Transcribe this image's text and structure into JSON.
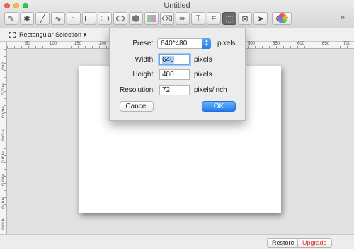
{
  "window": {
    "title": "Untitled"
  },
  "toolbar": {
    "tools": [
      {
        "name": "eyedropper-icon",
        "glyph": "✎"
      },
      {
        "name": "magic-wand-icon",
        "glyph": "✱"
      },
      {
        "name": "line-icon",
        "glyph": "╱"
      },
      {
        "name": "bezier-curve-icon",
        "glyph": "∿"
      },
      {
        "name": "freehand-curve-icon",
        "glyph": "~"
      },
      {
        "name": "rectangle-icon",
        "glyph": ""
      },
      {
        "name": "rounded-rectangle-icon",
        "glyph": ""
      },
      {
        "name": "ellipse-icon",
        "glyph": ""
      },
      {
        "name": "polygon-icon",
        "glyph": ""
      },
      {
        "name": "gradient-icon",
        "glyph": ""
      },
      {
        "name": "eraser-icon",
        "glyph": "⌫"
      },
      {
        "name": "pencil-icon",
        "glyph": "✏"
      },
      {
        "name": "text-icon",
        "glyph": "T"
      },
      {
        "name": "crop-icon",
        "glyph": "⌗"
      },
      {
        "name": "rectangular-selection-icon",
        "glyph": "⬚"
      },
      {
        "name": "magic-selection-icon",
        "glyph": "⊠"
      },
      {
        "name": "pointer-icon",
        "glyph": "➤"
      }
    ],
    "settings_glyph": "⚙ ▾",
    "more_glyph": "»"
  },
  "subbar": {
    "selection_label": "Rectangular Selection",
    "dropdown_glyph": "▾"
  },
  "ruler": {
    "h_ticks": [
      "50",
      "100",
      "150",
      "200",
      "250",
      "300",
      "350",
      "400",
      "450",
      "500",
      "550",
      "600",
      "650",
      "700"
    ],
    "v_ticks": [
      "5\n0",
      "1\n0\n0",
      "1\n5\n0",
      "2\n0\n0",
      "2\n5\n0",
      "3\n0\n0",
      "3\n5\n0",
      "4\n0\n0",
      "4\n5\n0"
    ]
  },
  "dialog": {
    "preset_label": "Preset:",
    "preset_value": "640*480",
    "preset_unit": "pixels",
    "width_label": "Width:",
    "width_value": "640",
    "width_unit": "pixels",
    "height_label": "Height:",
    "height_value": "480",
    "height_unit": "pixels",
    "resolution_label": "Resolution:",
    "resolution_value": "72",
    "resolution_unit": "pixels/inch",
    "cancel_label": "Cancel",
    "ok_label": "OK"
  },
  "bottom": {
    "restore_label": "Restore",
    "upgrade_label": "Upgrade"
  },
  "colors": {
    "accent": "#2a7ce8",
    "upgrade": "#d8322e"
  }
}
